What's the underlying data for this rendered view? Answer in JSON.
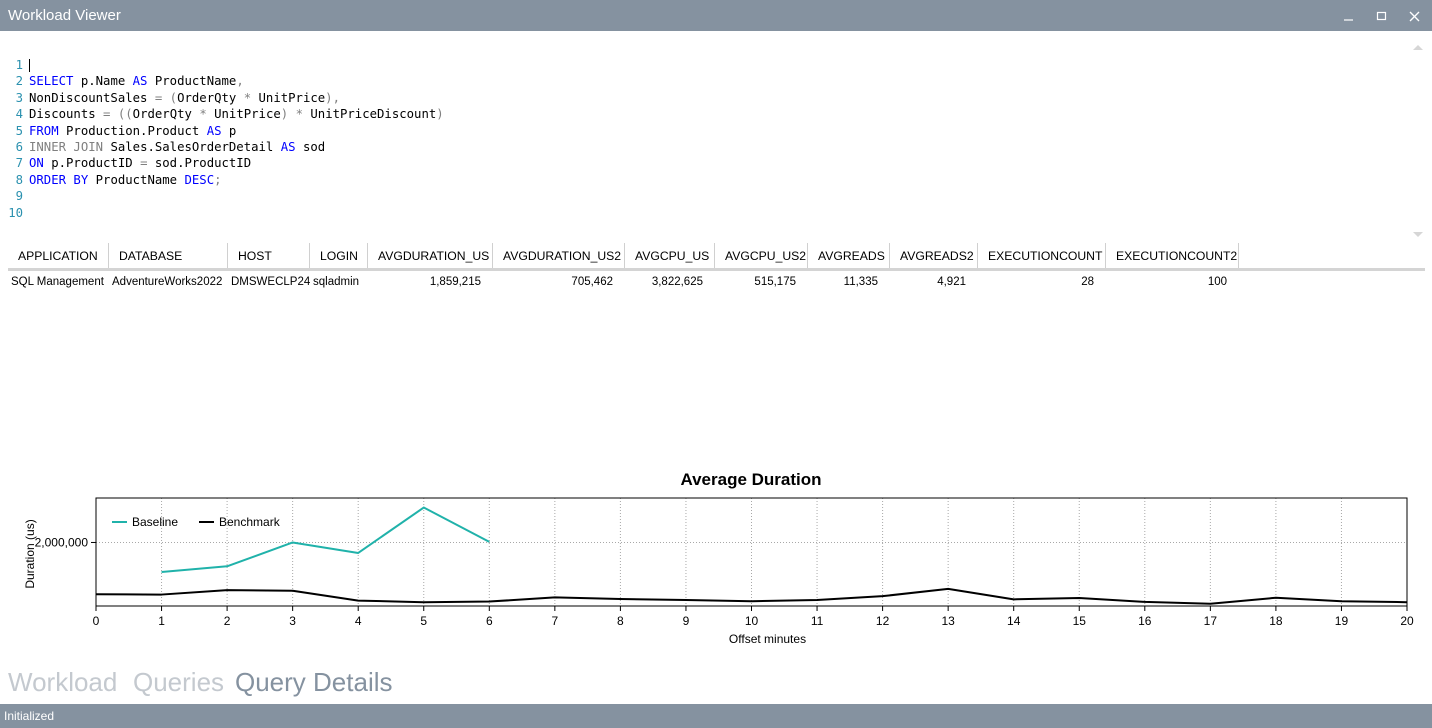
{
  "window": {
    "title": "Workload Viewer",
    "controls": [
      "minimize-icon",
      "maximize-icon",
      "close-icon"
    ]
  },
  "editor": {
    "line_numbers": [
      "1",
      "2",
      "3",
      "4",
      "5",
      "6",
      "7",
      "8",
      "9",
      "10"
    ],
    "lines": [
      [],
      [
        {
          "t": "SELECT",
          "c": "kw"
        },
        {
          "t": " p.Name ",
          "c": ""
        },
        {
          "t": "AS",
          "c": "kw"
        },
        {
          "t": " ProductName",
          "c": ""
        },
        {
          "t": ",",
          "c": "gray"
        }
      ],
      [
        {
          "t": "NonDiscountSales ",
          "c": ""
        },
        {
          "t": "=",
          "c": "gray"
        },
        {
          "t": " ",
          "c": ""
        },
        {
          "t": "(",
          "c": "gray"
        },
        {
          "t": "OrderQty ",
          "c": ""
        },
        {
          "t": "*",
          "c": "gray"
        },
        {
          "t": " UnitPrice",
          "c": ""
        },
        {
          "t": "),",
          "c": "gray"
        }
      ],
      [
        {
          "t": "Discounts ",
          "c": ""
        },
        {
          "t": "=",
          "c": "gray"
        },
        {
          "t": " ",
          "c": ""
        },
        {
          "t": "((",
          "c": "gray"
        },
        {
          "t": "OrderQty ",
          "c": ""
        },
        {
          "t": "*",
          "c": "gray"
        },
        {
          "t": " UnitPrice",
          "c": ""
        },
        {
          "t": ")",
          "c": "gray"
        },
        {
          "t": " ",
          "c": ""
        },
        {
          "t": "*",
          "c": "gray"
        },
        {
          "t": " UnitPriceDiscount",
          "c": ""
        },
        {
          "t": ")",
          "c": "gray"
        }
      ],
      [
        {
          "t": "FROM",
          "c": "kw"
        },
        {
          "t": " Production.Product ",
          "c": ""
        },
        {
          "t": "AS",
          "c": "kw"
        },
        {
          "t": " p",
          "c": ""
        }
      ],
      [
        {
          "t": "INNER JOIN",
          "c": "gray"
        },
        {
          "t": " Sales.SalesOrderDetail ",
          "c": ""
        },
        {
          "t": "AS",
          "c": "kw"
        },
        {
          "t": " sod",
          "c": ""
        }
      ],
      [
        {
          "t": "ON",
          "c": "kw"
        },
        {
          "t": " p.ProductID ",
          "c": ""
        },
        {
          "t": "=",
          "c": "gray"
        },
        {
          "t": " sod.ProductID",
          "c": ""
        }
      ],
      [
        {
          "t": "ORDER BY",
          "c": "kw"
        },
        {
          "t": " ProductName ",
          "c": ""
        },
        {
          "t": "DESC",
          "c": "kw"
        },
        {
          "t": ";",
          "c": "gray"
        }
      ],
      [],
      []
    ]
  },
  "grid": {
    "columns": [
      "APPLICATION",
      "DATABASE",
      "HOST",
      "LOGIN",
      "AVGDURATION_US",
      "AVGDURATION_US2",
      "AVGCPU_US",
      "AVGCPU_US2",
      "AVGREADS",
      "AVGREADS2",
      "EXECUTIONCOUNT",
      "EXECUTIONCOUNT2"
    ],
    "rows": [
      [
        "SQL Management",
        "AdventureWorks2022",
        "DMSWECLP24",
        "sqladmin",
        "1,859,215",
        "705,462",
        "3,822,625",
        "515,175",
        "11,335",
        "4,921",
        "28",
        "100"
      ]
    ]
  },
  "chart_data": {
    "type": "line",
    "title": "Average Duration",
    "xlabel": "Offset minutes",
    "ylabel": "Duration (us)",
    "xlim": [
      0,
      20
    ],
    "ylim": [
      0,
      3400000
    ],
    "xticks": [
      0,
      1,
      2,
      3,
      4,
      5,
      6,
      7,
      8,
      9,
      10,
      11,
      12,
      13,
      14,
      15,
      16,
      17,
      18,
      19,
      20
    ],
    "yticks": [
      2000000
    ],
    "ytick_labels": [
      "2,000,000"
    ],
    "grid": true,
    "legend_position": "top-left",
    "series": [
      {
        "name": "Baseline",
        "color": "#20b2aa",
        "x": [
          1,
          2,
          3,
          4,
          5,
          6
        ],
        "y": [
          1070000,
          1250000,
          2000000,
          1670000,
          3100000,
          2020000
        ]
      },
      {
        "name": "Benchmark",
        "color": "#000000",
        "x": [
          0,
          1,
          2,
          3,
          4,
          5,
          6,
          7,
          8,
          9,
          10,
          11,
          12,
          13,
          14,
          15,
          16,
          17,
          18,
          19,
          20
        ],
        "y": [
          370000,
          360000,
          500000,
          480000,
          170000,
          120000,
          140000,
          270000,
          220000,
          190000,
          150000,
          190000,
          310000,
          540000,
          210000,
          250000,
          130000,
          70000,
          260000,
          150000,
          120000
        ]
      }
    ]
  },
  "nav": {
    "tabs": [
      "Workload",
      "Queries",
      "Query Details"
    ],
    "active_index": 2
  },
  "status": {
    "text": "Initialized"
  }
}
